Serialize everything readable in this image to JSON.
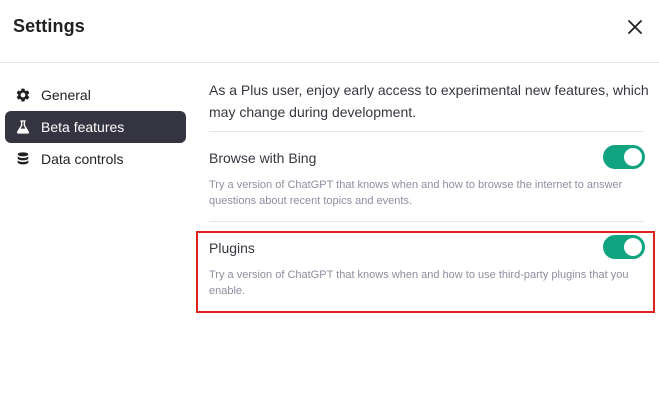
{
  "dialog": {
    "title": "Settings",
    "close_icon": "close-icon"
  },
  "sidebar": {
    "items": [
      {
        "label": "General",
        "icon": "gear-icon",
        "active": false
      },
      {
        "label": "Beta features",
        "icon": "flask-icon",
        "active": true
      },
      {
        "label": "Data controls",
        "icon": "database-icon",
        "active": false
      }
    ]
  },
  "main": {
    "intro": "As a Plus user, enjoy early access to experimental new features, which may change during development.",
    "features": [
      {
        "title": "Browse with Bing",
        "description": "Try a version of ChatGPT that knows when and how to browse the internet to answer questions about recent topics and events.",
        "enabled": true
      },
      {
        "title": "Plugins",
        "description": "Try a version of ChatGPT that knows when and how to use third-party plugins that you enable.",
        "enabled": true
      }
    ]
  },
  "colors": {
    "toggle_on": "#10a37f",
    "active_nav_bg": "#343541",
    "highlight_border": "#e0201b"
  }
}
